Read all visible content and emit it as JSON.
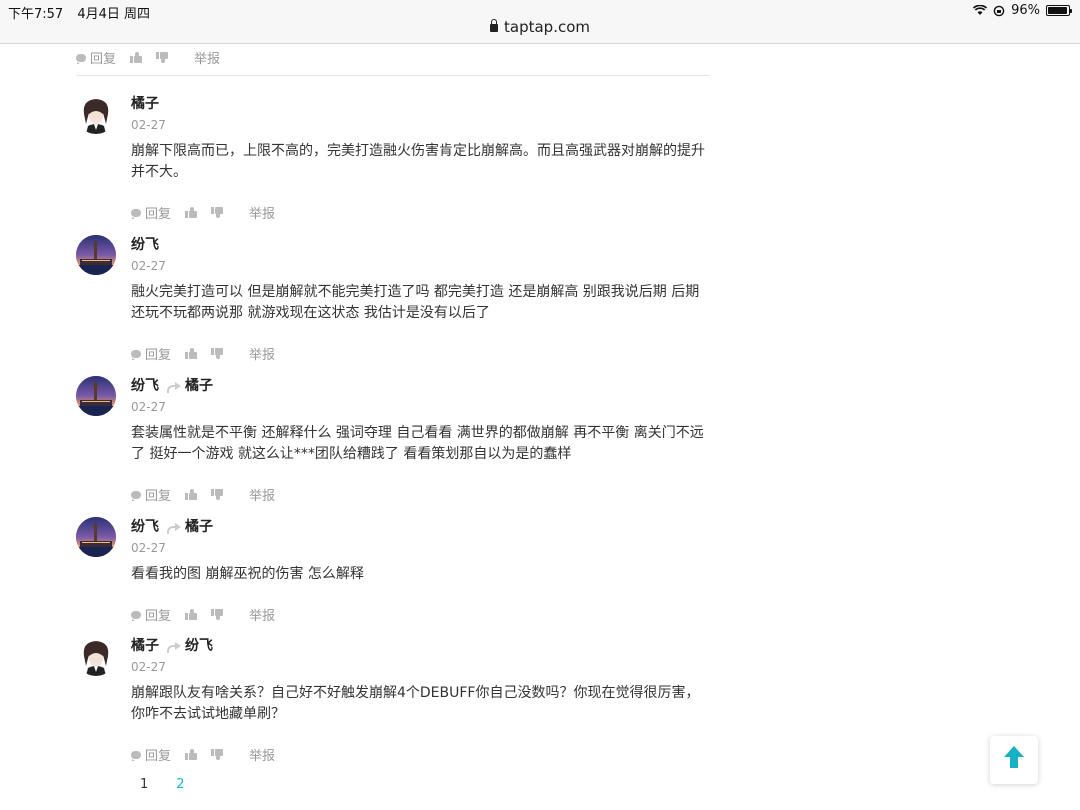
{
  "status_bar": {
    "time": "下午7:57",
    "date": "4月4日 周四",
    "battery": "96%",
    "battery_level": 0.96
  },
  "url": "taptap.com",
  "action_labels": {
    "reply": "回复",
    "report": "举报"
  },
  "comments": [
    {
      "author": "橘子",
      "reply_to": "",
      "date": "02-27",
      "avatar": "anime",
      "text": "崩解下限高而已，上限不高的，完美打造融火伤害肯定比崩解高。而且高强武器对崩解的提升并不大。"
    },
    {
      "author": "纷飞",
      "reply_to": "",
      "date": "02-27",
      "avatar": "city",
      "text": "融火完美打造可以 但是崩解就不能完美打造了吗 都完美打造 还是崩解高 别跟我说后期 后期还玩不玩都两说那 就游戏现在这状态 我估计是没有以后了"
    },
    {
      "author": "纷飞",
      "reply_to": "橘子",
      "date": "02-27",
      "avatar": "city",
      "text": "套装属性就是不平衡 还解释什么 强词夺理 自己看看 满世界的都做崩解 再不平衡 离关门不远了 挺好一个游戏 就这么让***团队给糟践了 看看策划那自以为是的蠢样"
    },
    {
      "author": "纷飞",
      "reply_to": "橘子",
      "date": "02-27",
      "avatar": "city",
      "text": "看看我的图 崩解巫祝的伤害 怎么解释"
    },
    {
      "author": "橘子",
      "reply_to": "纷飞",
      "date": "02-27",
      "avatar": "anime",
      "text": "崩解跟队友有啥关系？自己好不好触发崩解4个DEBUFF你自己没数吗？你现在觉得很厉害，你咋不去试试地藏单刷？"
    }
  ],
  "pagination": {
    "current": "1",
    "next": "2"
  }
}
